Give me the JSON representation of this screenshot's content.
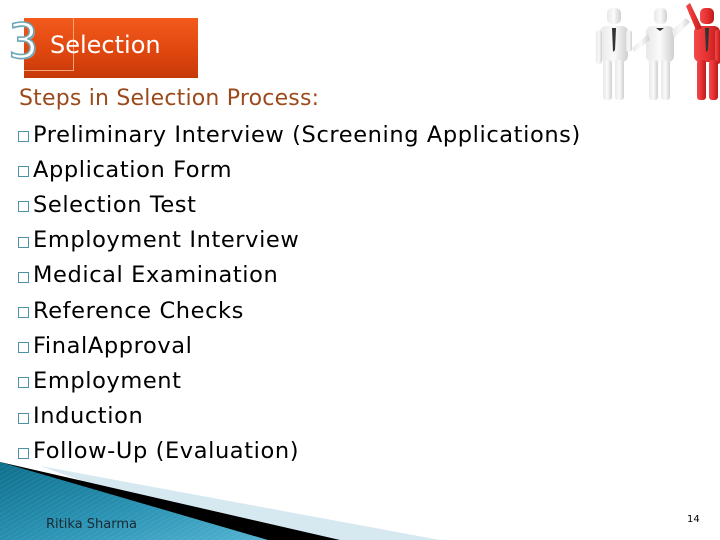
{
  "slide": {
    "number_badge": "3",
    "title": "Selection",
    "heading": "Steps in Selection Process:",
    "steps": [
      "Preliminary Interview (Screening Applications)",
      "Application Form",
      "Selection Test",
      "Employment Interview",
      "Medical Examination",
      "Reference Checks",
      "FinalApproval",
      "Employment",
      "Induction",
      "Follow-Up (Evaluation)"
    ],
    "illustration": "three-business-figures-one-red-raising-hand",
    "footer": {
      "author": "Ritika Sharma",
      "page_number": "14"
    }
  },
  "colors": {
    "title_bg": "#e0470f",
    "heading": "#9c4a1c",
    "bullet": "#4f92a8",
    "footer_teal": "#2a8fae",
    "footer_black": "#000000",
    "footer_light": "#d6e9f0",
    "figure_red": "#e03030"
  }
}
